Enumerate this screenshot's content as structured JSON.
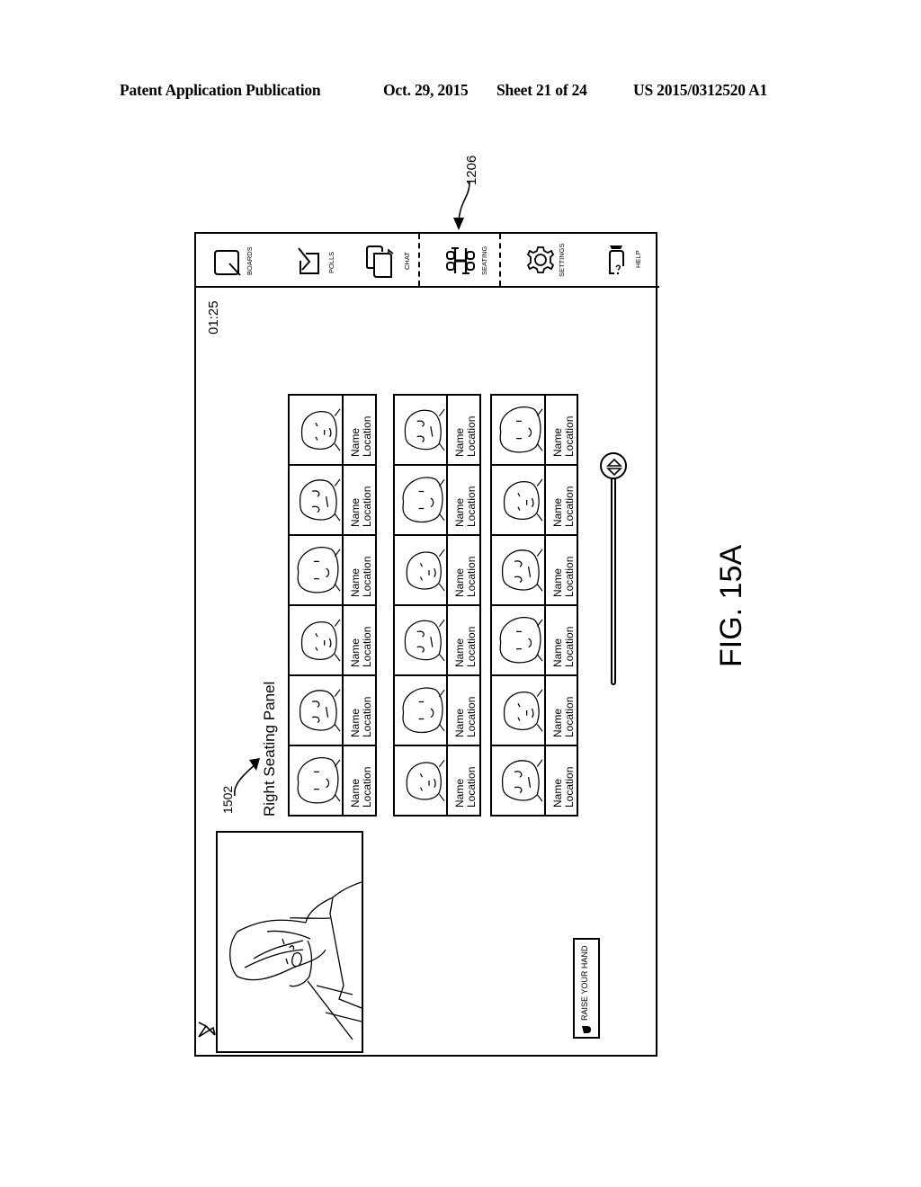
{
  "header": {
    "publication": "Patent Application Publication",
    "date": "Oct. 29, 2015",
    "sheet": "Sheet 21 of 24",
    "number": "US 2015/0312520 A1"
  },
  "figure": {
    "label": "FIG. 15A",
    "ref_toolbar_item": "1206",
    "ref_panel": "1502"
  },
  "toolbar": {
    "items": [
      {
        "label": "BOARDS",
        "icon": "boards-icon"
      },
      {
        "label": "POLLS",
        "icon": "polls-icon"
      },
      {
        "label": "CHAT",
        "icon": "chat-icon"
      },
      {
        "label": "SEATING",
        "icon": "seating-icon",
        "selected": true
      },
      {
        "label": "SETTINGS",
        "icon": "gear-icon"
      },
      {
        "label": "HELP",
        "icon": "help-icon"
      }
    ]
  },
  "session": {
    "timer": "01:25"
  },
  "panel": {
    "title": "Right Seating Panel",
    "rows": [
      {
        "seats": [
          {
            "name": "Name",
            "location": "Location"
          },
          {
            "name": "Name",
            "location": "Location"
          },
          {
            "name": "Name",
            "location": "Location"
          },
          {
            "name": "Name",
            "location": "Location"
          },
          {
            "name": "Name",
            "location": "Location"
          },
          {
            "name": "Name",
            "location": "Location"
          }
        ]
      },
      {
        "seats": [
          {
            "name": "Name",
            "location": "Location"
          },
          {
            "name": "Name",
            "location": "Location"
          },
          {
            "name": "Name",
            "location": "Location"
          },
          {
            "name": "Name",
            "location": "Location"
          },
          {
            "name": "Name",
            "location": "Location"
          },
          {
            "name": "Name",
            "location": "Location"
          }
        ]
      },
      {
        "seats": [
          {
            "name": "Name",
            "location": "Location"
          },
          {
            "name": "Name",
            "location": "Location"
          },
          {
            "name": "Name",
            "location": "Location"
          },
          {
            "name": "Name",
            "location": "Location"
          },
          {
            "name": "Name",
            "location": "Location"
          },
          {
            "name": "Name",
            "location": "Location"
          }
        ]
      }
    ]
  },
  "controls": {
    "raise_hand": "RAISE YOUR HAND",
    "scroll_position": 0
  }
}
